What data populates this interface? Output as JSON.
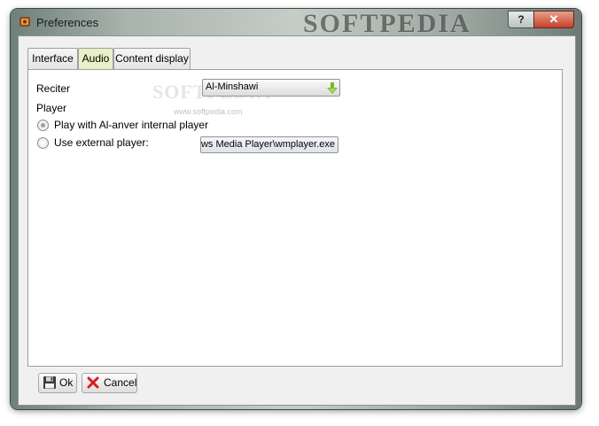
{
  "window": {
    "title": "Preferences",
    "watermark": "SOFTPEDIA",
    "help_label": "?",
    "close_label": "✕"
  },
  "tabs": [
    {
      "label": "Interface",
      "active": false
    },
    {
      "label": "Audio",
      "active": true
    },
    {
      "label": "Content display",
      "active": false
    }
  ],
  "audio": {
    "reciter_label": "Reciter",
    "reciter_value": "Al-Minshawi",
    "player_label": "Player",
    "option_internal": "Play with Al-anver internal player",
    "option_external": "Use external player:",
    "selected_option": "internal",
    "external_path": "ows Media Player\\wmplayer.exe",
    "panel_watermark": "SOFTPEDIA",
    "panel_watermark_url": "www.softpedia.com"
  },
  "buttons": {
    "ok_label": "Ok",
    "cancel_label": "Cancel"
  },
  "colors": {
    "active_tab": "#e8efc9",
    "close_button": "#c7402a",
    "combo_arrow": "#7cb82f",
    "cancel_icon": "#d32020"
  },
  "icons": {
    "app": "app-icon",
    "combo_arrow": "green-down-arrow-icon",
    "ok": "floppy-disk-icon",
    "cancel": "red-x-icon"
  }
}
